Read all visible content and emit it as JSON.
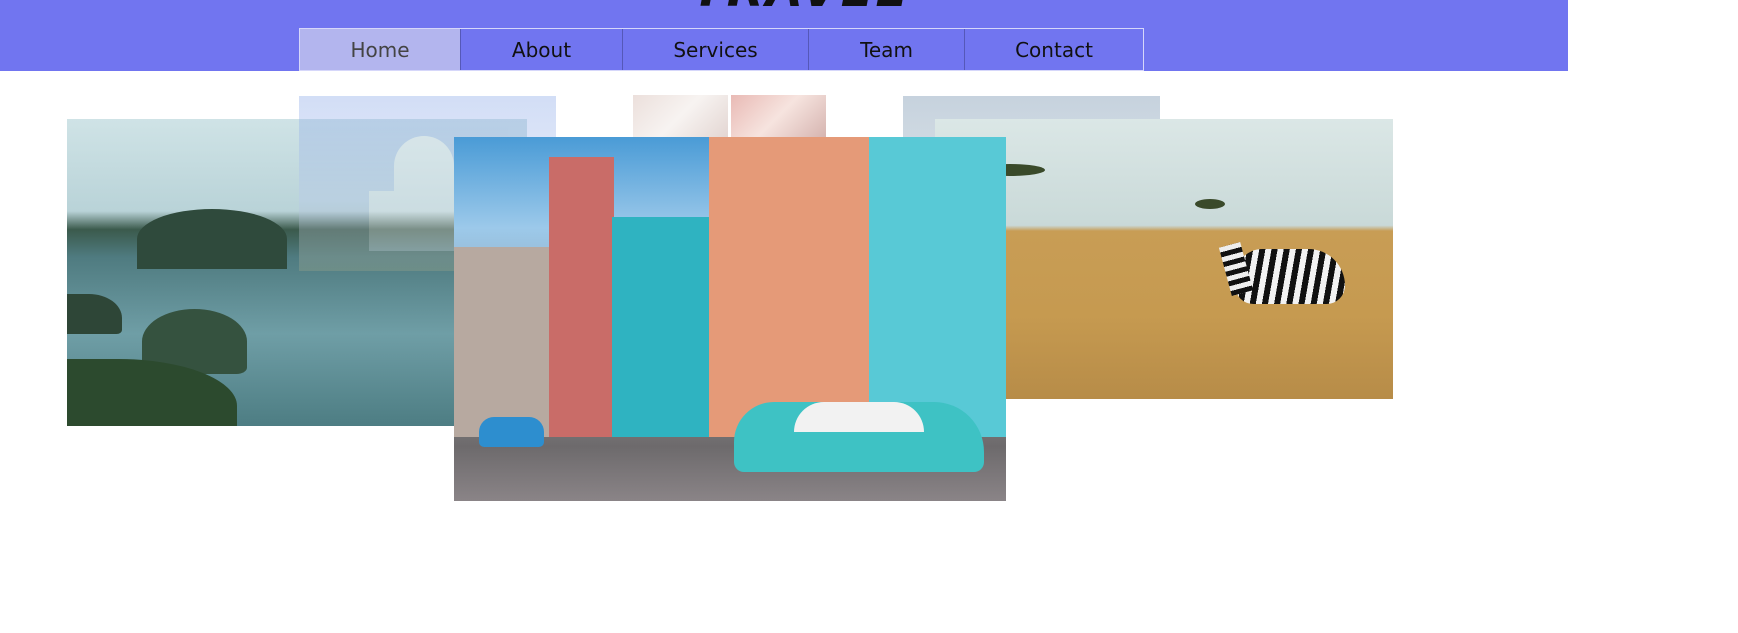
{
  "header": {
    "title": "TRAVEL",
    "background_color": "#7175f0",
    "nav": [
      {
        "label": "Home",
        "active": true
      },
      {
        "label": "About",
        "active": false
      },
      {
        "label": "Services",
        "active": false
      },
      {
        "label": "Team",
        "active": false
      },
      {
        "label": "Contact",
        "active": false
      }
    ]
  },
  "gallery": {
    "images": [
      {
        "subject": "Ha Long Bay islands with boats",
        "opacity": "full"
      },
      {
        "subject": "Taj Mahal",
        "opacity": "faded"
      },
      {
        "subject": "Small thumbnails",
        "opacity": "faded"
      },
      {
        "subject": "Savanna landscape",
        "opacity": "faded"
      },
      {
        "subject": "Zebra on savanna grassland",
        "opacity": "full"
      },
      {
        "subject": "Colorful Havana street with classic car",
        "opacity": "full"
      }
    ]
  }
}
